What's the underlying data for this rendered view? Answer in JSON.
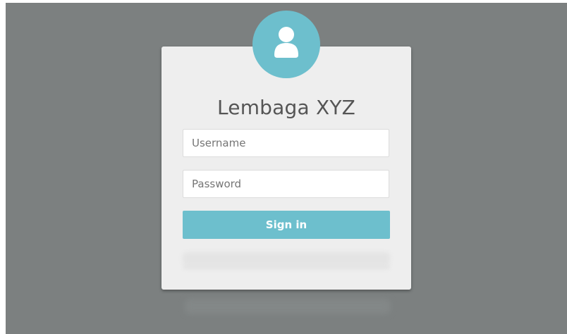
{
  "login": {
    "title": "Lembaga XYZ",
    "username_placeholder": "Username",
    "password_placeholder": "Password",
    "signin_label": "Sign in"
  },
  "avatar": {
    "icon": "user-icon"
  },
  "colors": {
    "background": "#7c8080",
    "card": "#eeeeee",
    "accent": "#6dbfcd"
  }
}
